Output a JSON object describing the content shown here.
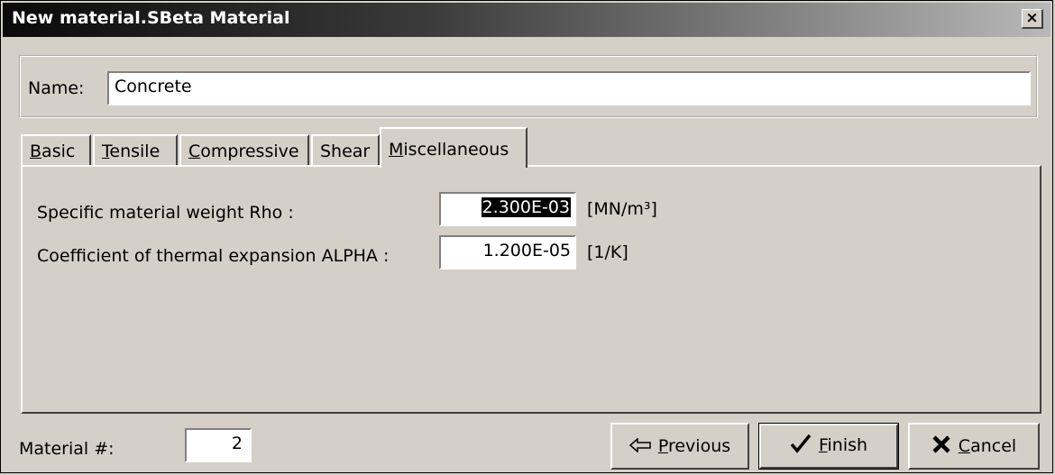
{
  "window": {
    "title": "New material.SBeta Material",
    "close_glyph": "×"
  },
  "name_field": {
    "label": "Name:",
    "value": "Concrete"
  },
  "tabs": [
    {
      "pre": "",
      "mnemonic": "B",
      "rest": "asic"
    },
    {
      "pre": "",
      "mnemonic": "T",
      "rest": "ensile"
    },
    {
      "pre": "",
      "mnemonic": "C",
      "rest": "ompressive"
    },
    {
      "pre": "Shear",
      "mnemonic": "",
      "rest": ""
    },
    {
      "pre": "",
      "mnemonic": "M",
      "rest": "iscellaneous"
    }
  ],
  "active_tab": "Miscellaneous",
  "fields": {
    "rho": {
      "label": "Specific material weight Rho :",
      "value": "2.300E-03",
      "unit": "[MN/m³]"
    },
    "alpha": {
      "label": "Coefficient of thermal expansion ALPHA :",
      "value": "1.200E-05",
      "unit": "[1/K]"
    }
  },
  "material_number": {
    "label": "Material #:",
    "value": "2"
  },
  "buttons": {
    "previous": {
      "mnemonic": "P",
      "rest": "revious",
      "icon": "left-arrow-icon"
    },
    "finish": {
      "mnemonic": "F",
      "rest": "inish",
      "icon": "check-icon"
    },
    "cancel": {
      "mnemonic": "C",
      "rest": "ancel",
      "icon": "x-icon"
    }
  }
}
